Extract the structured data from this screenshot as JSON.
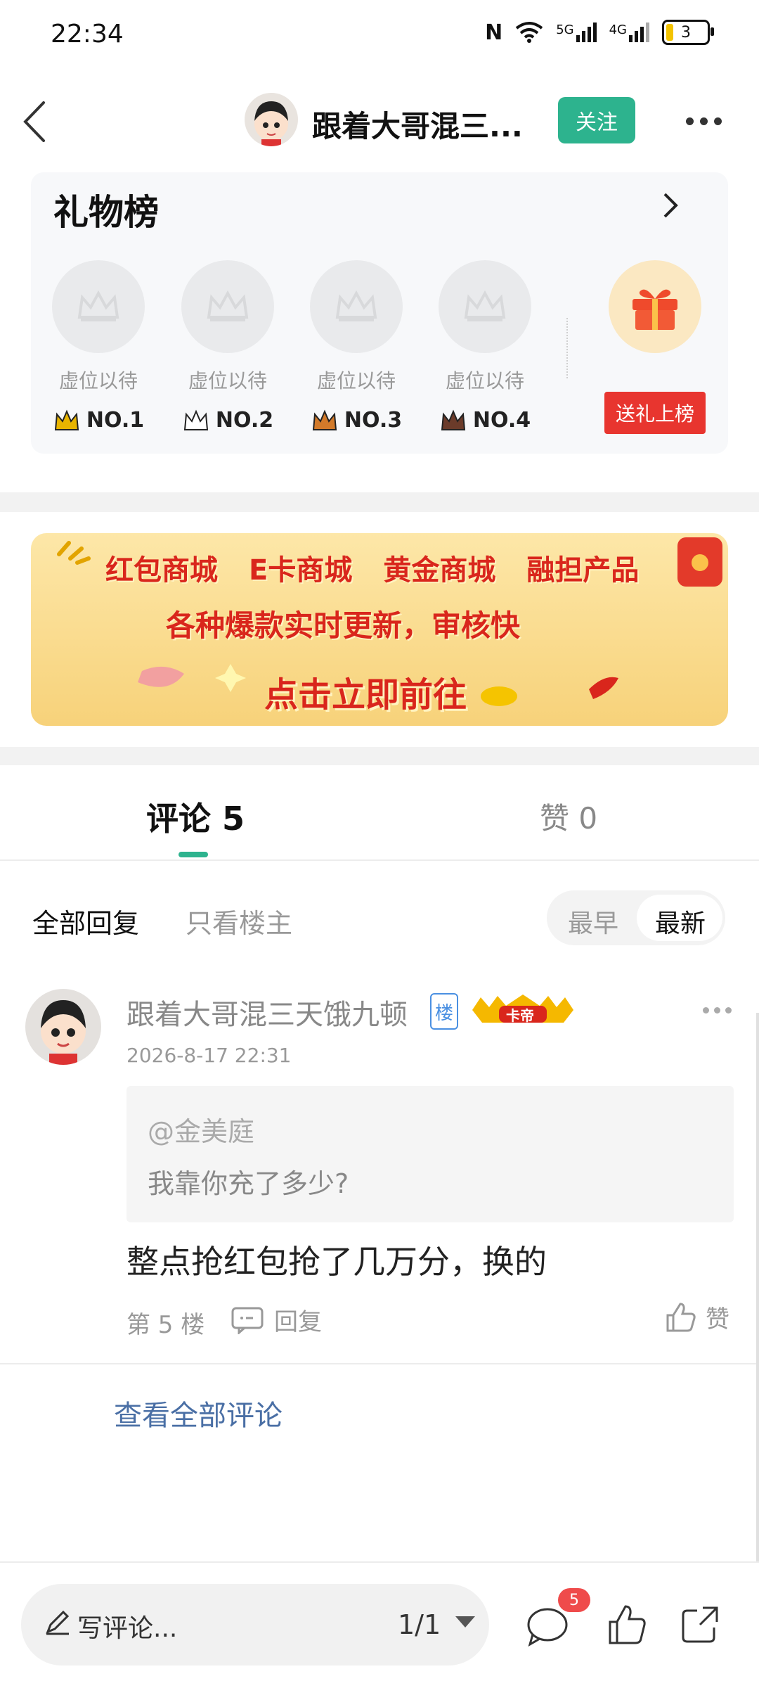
{
  "status_bar": {
    "time": "22:34",
    "battery": "3",
    "net1": "5G",
    "net2": "4G"
  },
  "header": {
    "title": "跟着大哥混三...",
    "follow_label": "关注"
  },
  "gift_board": {
    "title": "礼物榜",
    "slots": [
      {
        "label": "虚位以待",
        "rank": "NO.1",
        "crown_color": "#e8b400"
      },
      {
        "label": "虚位以待",
        "rank": "NO.2",
        "crown_color": "#8a9aaa"
      },
      {
        "label": "虚位以待",
        "rank": "NO.3",
        "crown_color": "#d27a2a"
      },
      {
        "label": "虚位以待",
        "rank": "NO.4",
        "crown_color": "#6b3b2a"
      }
    ],
    "send_gift_label": "送礼上榜"
  },
  "banner": {
    "row1": [
      "红包商城",
      "E卡商城",
      "黄金商城",
      "融担产品"
    ],
    "row2": "各种爆款实时更新，审核快",
    "row3": "点击立即前往"
  },
  "tabs": {
    "comments": "评论 5",
    "likes": "赞 0"
  },
  "filters": {
    "all": "全部回复",
    "owner_only": "只看楼主",
    "earliest": "最早",
    "latest": "最新"
  },
  "comment": {
    "author": "跟着大哥混三天饿九顿",
    "floor_badge": "楼",
    "crown_badge": "卡帝",
    "time": "2026-8-17 22:31",
    "quote_mention": "@金美庭",
    "quote_text": "我靠你充了多少?",
    "body": "整点抢红包抢了几万分，换的",
    "floor": "第 5 楼",
    "reply_label": "回复",
    "like_label": "赞"
  },
  "view_all": "查看全部评论",
  "bottom_bar": {
    "write_placeholder": "写评论...",
    "page": "1/1",
    "comment_count": "5"
  },
  "colors": {
    "accent": "#2db38e",
    "red": "#e8352f",
    "link": "#4a6fa5"
  }
}
